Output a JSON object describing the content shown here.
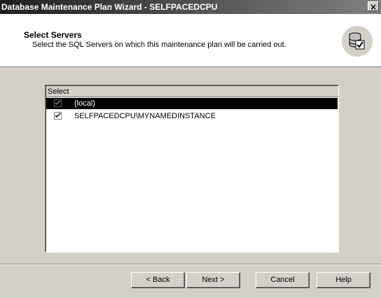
{
  "window": {
    "title": "Database Maintenance Plan Wizard - SELFPACEDCPU",
    "close_label": "×"
  },
  "header": {
    "title": "Select Servers",
    "description": "Select the SQL Servers on which this maintenance plan will be carried out.",
    "icon": "database-check-icon"
  },
  "list": {
    "column_header": "Select",
    "rows": [
      {
        "label": "(local)",
        "checked": true,
        "selected": true,
        "disabled": true
      },
      {
        "label": "SELFPACEDCPU\\MYNAMEDINSTANCE",
        "checked": true,
        "selected": false,
        "disabled": false
      }
    ]
  },
  "buttons": {
    "back": "< Back",
    "next": "Next >",
    "cancel": "Cancel",
    "help": "Help"
  }
}
